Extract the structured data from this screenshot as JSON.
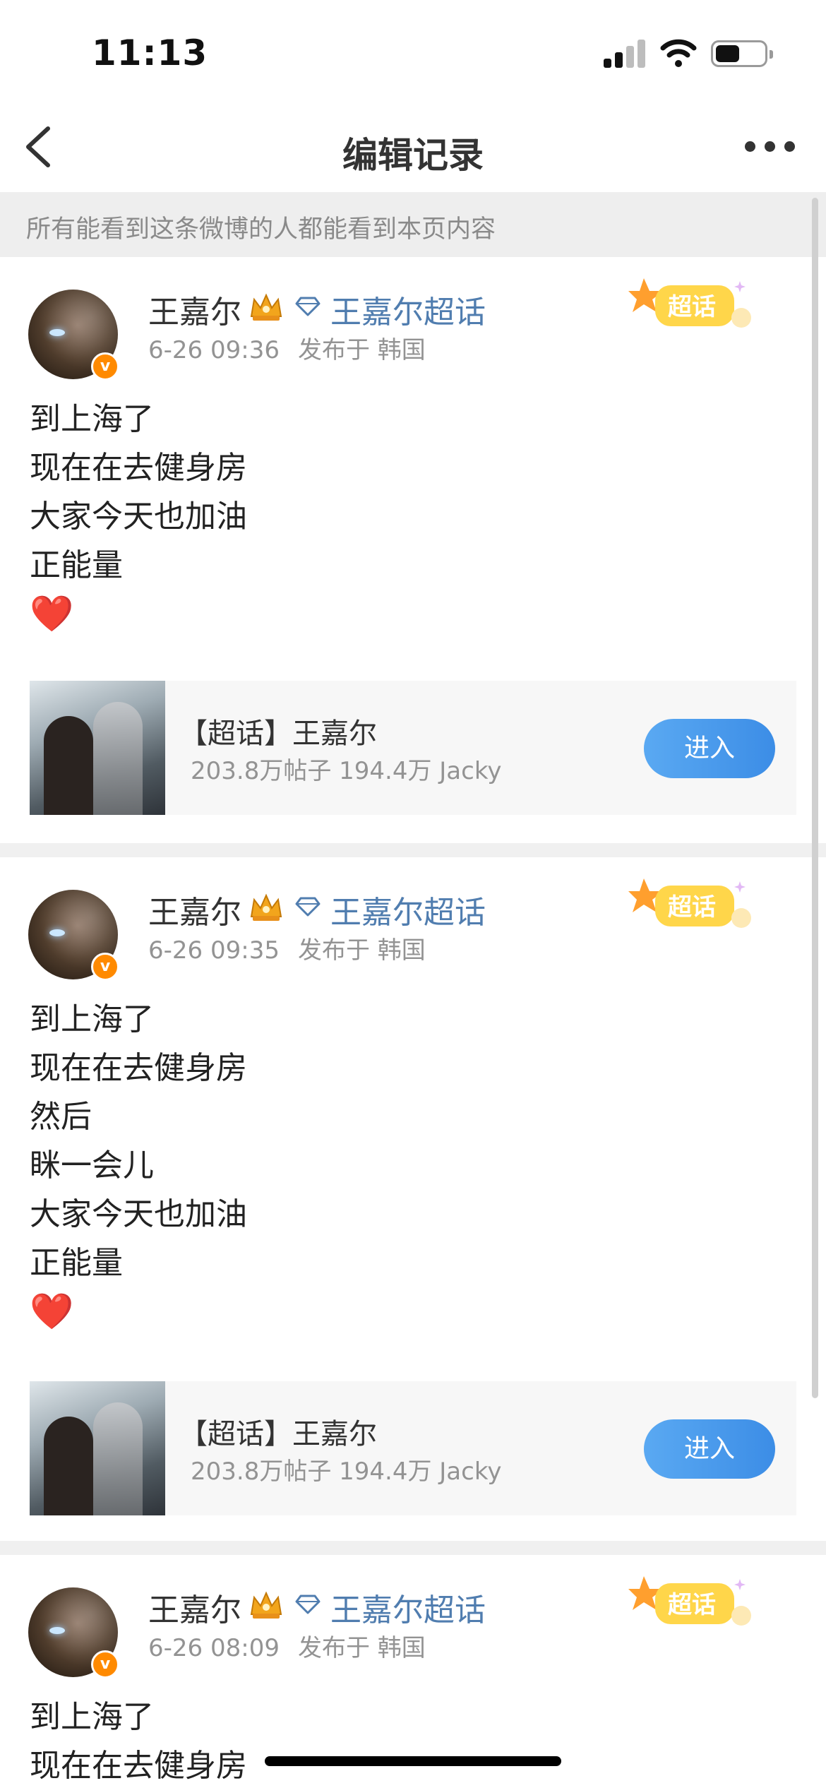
{
  "status_bar": {
    "time": "11:13"
  },
  "nav": {
    "title": "编辑记录"
  },
  "banner": {
    "text": "所有能看到这条微博的人都能看到本页内容"
  },
  "posts": [
    {
      "author": "王嘉尔",
      "supertopic_link": "王嘉尔超话",
      "time": "6-26 09:36",
      "location": "发布于 韩国",
      "lines": [
        "到上海了",
        "现在在去健身房",
        "大家今天也加油",
        "正能量"
      ],
      "emoji": "❤️",
      "card": {
        "title": "【超话】王嘉尔",
        "stats": "203.8万帖子 194.4万 Jacky",
        "button": "进入"
      }
    },
    {
      "author": "王嘉尔",
      "supertopic_link": "王嘉尔超话",
      "time": "6-26 09:35",
      "location": "发布于 韩国",
      "lines": [
        "到上海了",
        "现在在去健身房",
        "然后",
        "眯一会儿",
        "大家今天也加油",
        "正能量"
      ],
      "emoji": "❤️",
      "card": {
        "title": "【超话】王嘉尔",
        "stats": "203.8万帖子 194.4万 Jacky",
        "button": "进入"
      }
    },
    {
      "author": "王嘉尔",
      "supertopic_link": "王嘉尔超话",
      "time": "6-26 08:09",
      "location": "发布于 韩国",
      "lines": [
        "到上海了",
        "现在在去健身房"
      ]
    }
  ],
  "sticker_text": "超话",
  "verified_badge": "v",
  "icons": [
    "back-arrow-icon",
    "more-icon",
    "crown-icon",
    "diamond-icon",
    "verified-icon",
    "heart-emoji"
  ],
  "colors": {
    "link_blue": "#507daf",
    "button_blue": "#4a9aea",
    "verified_orange": "#ff8a00",
    "heart_red": "#e0211b"
  }
}
